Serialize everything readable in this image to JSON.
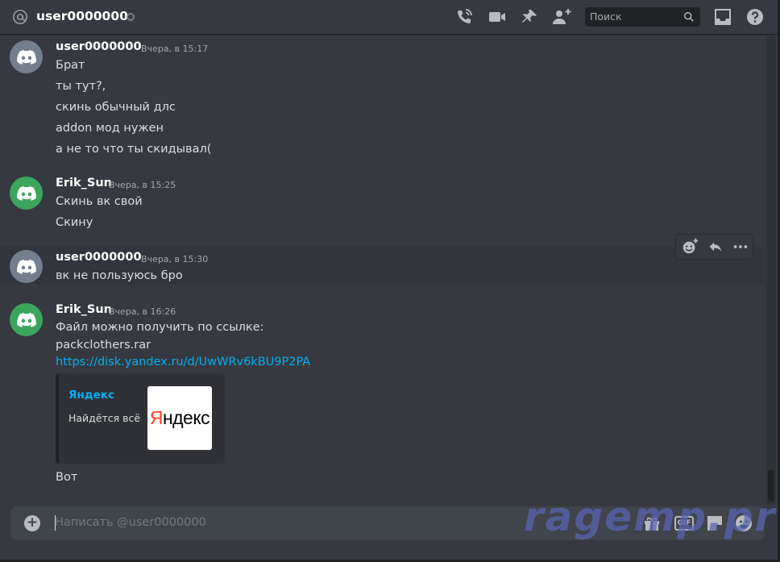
{
  "header": {
    "title": "user0000000",
    "search_placeholder": "Поиск",
    "icons": [
      "at-icon",
      "phone-call-icon",
      "video-call-icon",
      "pin-icon",
      "add-friend-icon",
      "search-icon",
      "inbox-icon",
      "help-icon"
    ]
  },
  "messages": [
    {
      "author": "user0000000",
      "time": "Вчера, в 15:17",
      "lines": [
        "Брат",
        "ты тут?,",
        "скинь обычный длс",
        "addon мод нужен",
        "а не то что ты скидывал("
      ]
    },
    {
      "author": "Erik_Sun",
      "time": "Вчера, в 15:25",
      "lines": [
        "Скинь вк свой",
        "Скину"
      ]
    },
    {
      "author": "user0000000",
      "time": "Вчера, в 15:30",
      "lines": [
        "вк не пользуюсь бро"
      ]
    },
    {
      "author": "Erik_Sun",
      "time": "Вчера, в 16:26",
      "lines": [
        "Файл можно получить по ссылке:",
        "packclothers.rar"
      ],
      "link": "https://disk.yandex.ru/d/UwWRv6kBU9P2PA",
      "embed": {
        "provider": "Яндекс",
        "description": "Найдётся всё",
        "thumbnail_text_first": "Я",
        "thumbnail_text_rest": "ндекс"
      },
      "after": "Вот"
    }
  ],
  "composer": {
    "placeholder": "Написать @user0000000",
    "gif_label": "GIF"
  },
  "watermark": "ragemp.pro",
  "colors": {
    "background": "#36393f",
    "link": "#00aff4",
    "avatar_gray": "#747f8d",
    "avatar_green": "#3ba55c",
    "yandex_red": "#fc3f1d"
  }
}
